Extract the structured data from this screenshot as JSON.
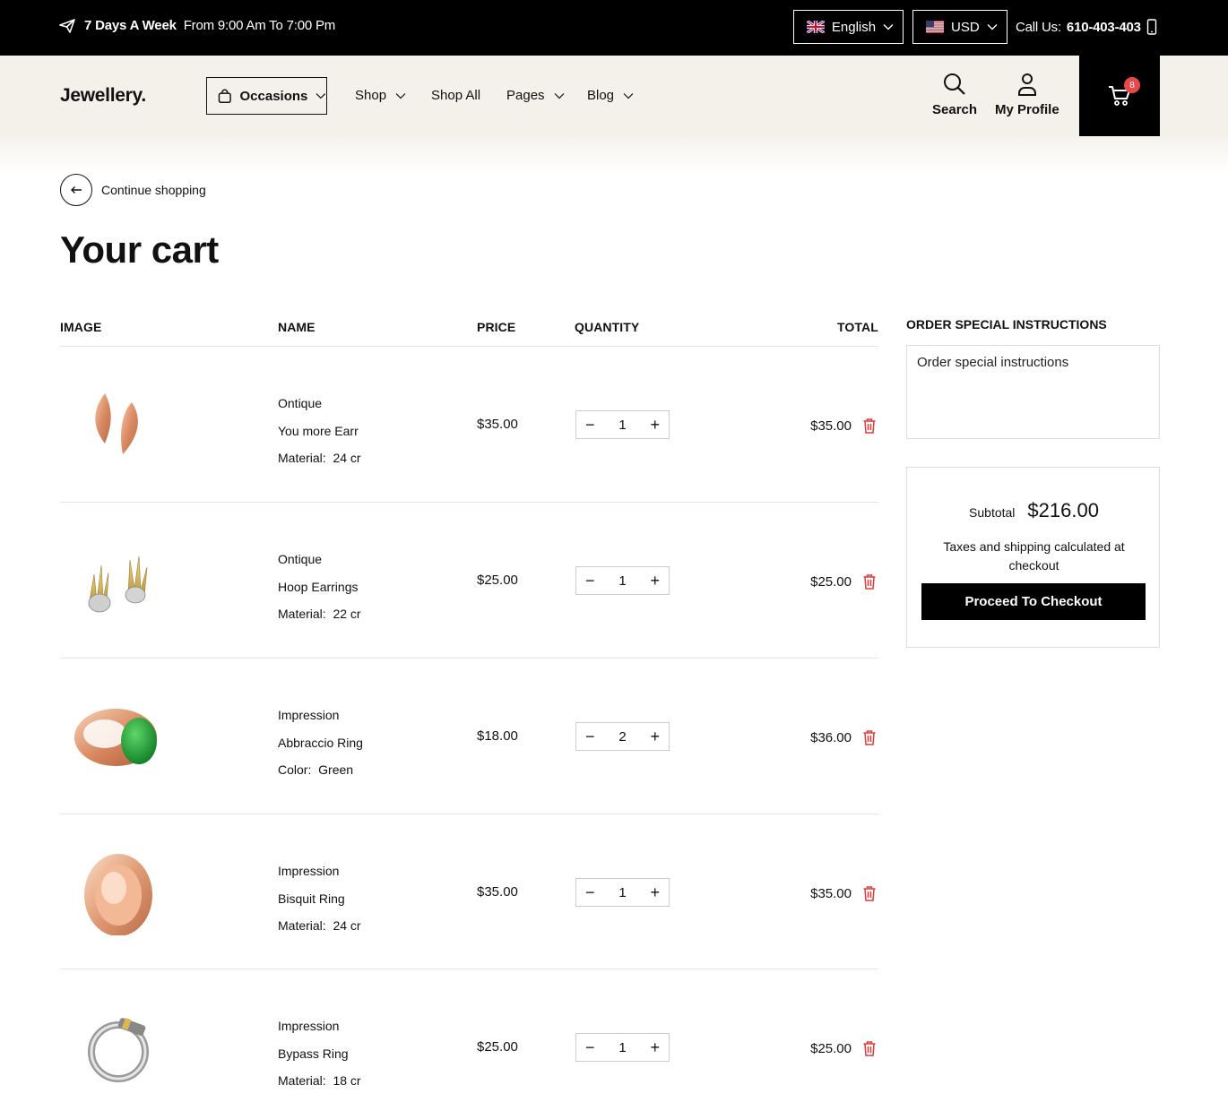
{
  "topbar": {
    "hours_bold": "7 Days A Week",
    "hours_rest": "From 9:00 Am To 7:00 Pm",
    "language": "English",
    "currency": "USD",
    "call_label": "Call Us:",
    "call_number": "610-403-403"
  },
  "nav": {
    "logo": "Jewellery.",
    "occasions": "Occasions",
    "menu": [
      "Shop",
      "Shop All",
      "Pages",
      "Blog"
    ],
    "search": "Search",
    "profile": "My Profile",
    "cart_count": "8"
  },
  "cart": {
    "back_label": "Continue shopping",
    "title": "Your cart",
    "headers": {
      "image": "IMAGE",
      "name": "NAME",
      "price": "PRICE",
      "quantity": "QUANTITY",
      "total": "TOTAL"
    },
    "items": [
      {
        "brand": "Ontique",
        "name": "You more Earr",
        "attr_label": "Material:",
        "attr_value": "24 cr",
        "price": "$35.00",
        "qty": "1",
        "total": "$35.00",
        "image": "rose-gold-leaf-earrings"
      },
      {
        "brand": "Ontique",
        "name": "Hoop Earrings",
        "attr_label": "Material:",
        "attr_value": "22 cr",
        "price": "$25.00",
        "qty": "1",
        "total": "$25.00",
        "image": "gold-diamond-wing-earrings"
      },
      {
        "brand": "Impression",
        "name": "Abbraccio Ring",
        "attr_label": "Color:",
        "attr_value": "Green",
        "price": "$18.00",
        "qty": "2",
        "total": "$36.00",
        "image": "rose-gold-emerald-ring"
      },
      {
        "brand": "Impression",
        "name": "Bisquit Ring",
        "attr_label": "Material:",
        "attr_value": "24 cr",
        "price": "$35.00",
        "qty": "1",
        "total": "$35.00",
        "image": "rose-gold-dome-ring"
      },
      {
        "brand": "Impression",
        "name": "Bypass Ring",
        "attr_label": "Material:",
        "attr_value": "18 cr",
        "price": "$25.00",
        "qty": "1",
        "total": "$25.00",
        "image": "silver-bypass-ring"
      }
    ]
  },
  "sidebar": {
    "instructions_title": "ORDER SPECIAL INSTRUCTIONS",
    "instructions_placeholder": "Order special instructions",
    "subtotal_label": "Subtotal",
    "subtotal_value": "$216.00",
    "taxes_note": "Taxes and shipping calculated at checkout",
    "checkout_label": "Proceed To Checkout"
  },
  "colors": {
    "accent": "#000000",
    "nav_bg": "#f4f0ea",
    "badge": "#e84848",
    "trash": "#e03b3b"
  }
}
